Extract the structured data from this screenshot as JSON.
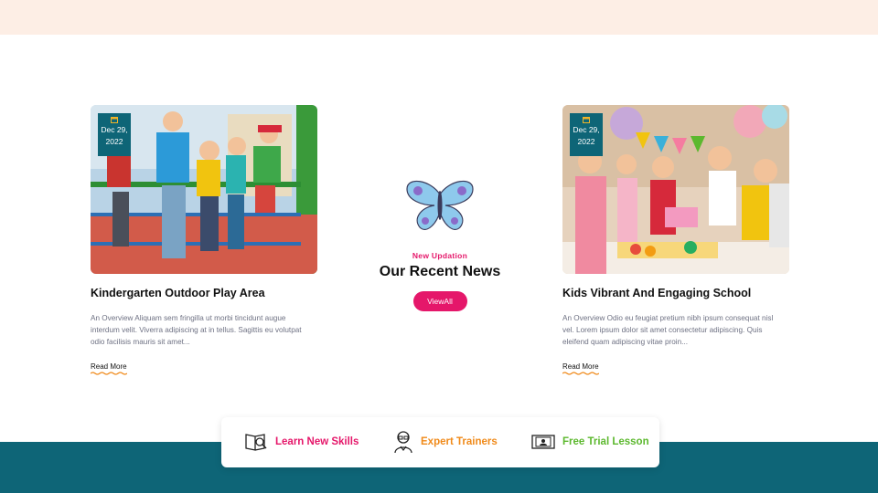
{
  "colors": {
    "accent": "#e5176a",
    "teal": "#0e6577",
    "orange": "#f08a1a",
    "green": "#5cb82e",
    "peach": "#fdeee5"
  },
  "cards": [
    {
      "date_line1": "Dec 29,",
      "date_line2": "2022",
      "title": "Kindergarten Outdoor Play Area",
      "text": "An Overview Aliquam sem fringilla ut morbi tincidunt augue interdum velit. Viverra adipiscing at in tellus. Sagittis eu volutpat odio facilisis mauris sit amet...",
      "read_more": "Read More"
    },
    {
      "date_line1": "Dec 29,",
      "date_line2": "2022",
      "title": "Kids Vibrant And Engaging School",
      "text": "An Overview Odio eu feugiat pretium nibh ipsum consequat nisl vel. Lorem ipsum dolor sit amet consectetur adipiscing. Quis eleifend quam adipiscing vitae proin...",
      "read_more": "Read More"
    }
  ],
  "center": {
    "kicker": "New Updation",
    "title": "Our Recent News",
    "button": "ViewAll"
  },
  "features": [
    {
      "label": "Learn New Skills",
      "icon": "book-search-icon"
    },
    {
      "label": "Expert Trainers",
      "icon": "trainer-icon"
    },
    {
      "label": "Free Trial Lesson",
      "icon": "video-lesson-icon"
    }
  ]
}
